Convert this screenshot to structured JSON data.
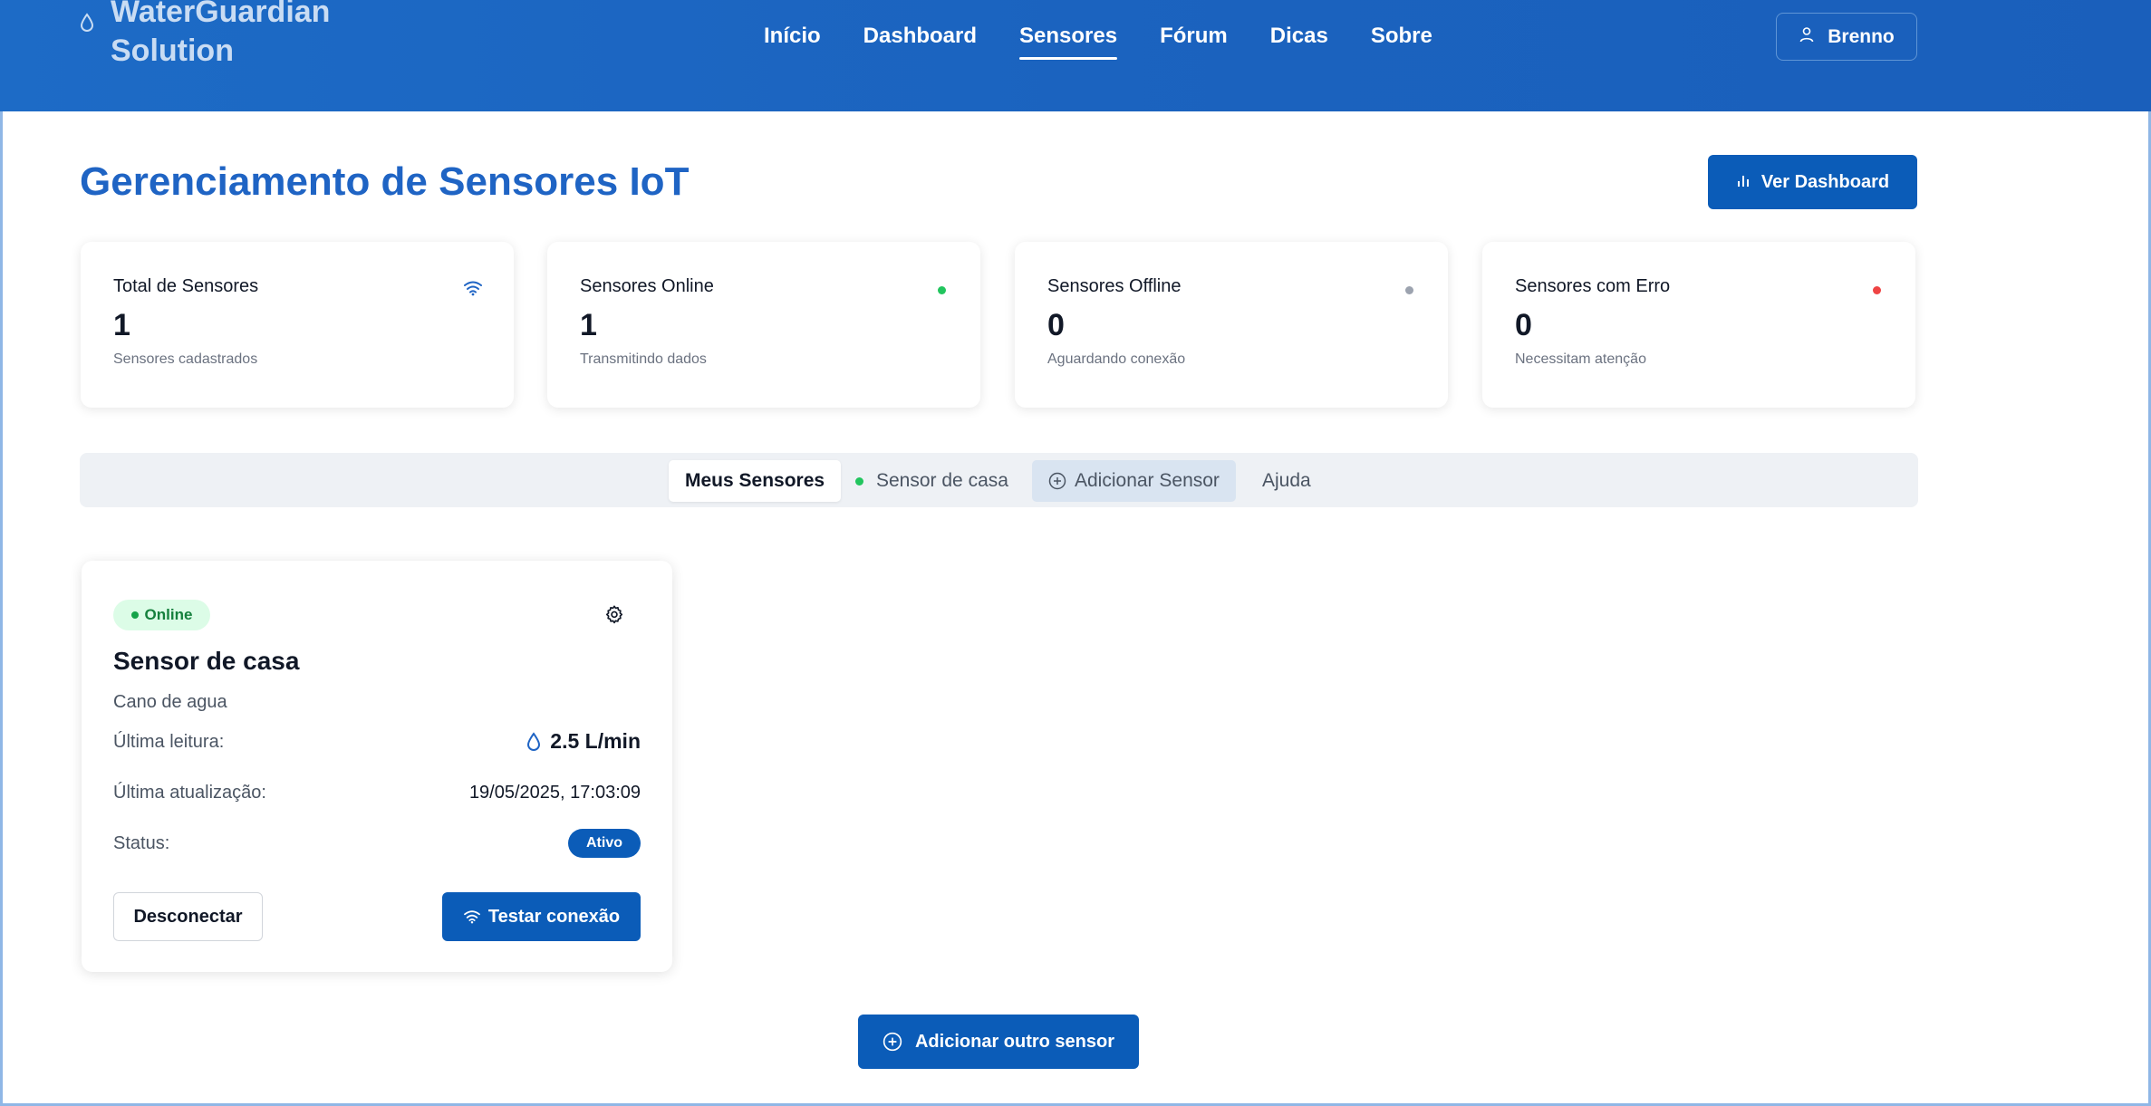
{
  "brand": {
    "name_line1": "WaterGuardian",
    "name_line2": "Solution"
  },
  "nav": {
    "items": [
      {
        "label": "Início"
      },
      {
        "label": "Dashboard"
      },
      {
        "label": "Sensores",
        "active": true
      },
      {
        "label": "Fórum"
      },
      {
        "label": "Dicas"
      },
      {
        "label": "Sobre"
      }
    ]
  },
  "user": {
    "name": "Brenno"
  },
  "page": {
    "title": "Gerenciamento de Sensores IoT",
    "dashboard_button": "Ver Dashboard"
  },
  "stats": [
    {
      "title": "Total de Sensores",
      "value": "1",
      "subtitle": "Sensores cadastrados",
      "icon": "wifi-icon"
    },
    {
      "title": "Sensores Online",
      "value": "1",
      "subtitle": "Transmitindo dados",
      "color": "#22c55e"
    },
    {
      "title": "Sensores Offline",
      "value": "0",
      "subtitle": "Aguardando conexão",
      "color": "#9ca3af"
    },
    {
      "title": "Sensores com Erro",
      "value": "0",
      "subtitle": "Necessitam atenção",
      "color": "#ef4444"
    }
  ],
  "tabs": {
    "my_sensors": "Meus Sensores",
    "sensor_home": "Sensor de casa",
    "add_sensor": "Adicionar Sensor",
    "help": "Ajuda"
  },
  "sensor": {
    "badge": "Online",
    "name": "Sensor de casa",
    "location": "Cano de agua",
    "last_reading_label": "Última leitura:",
    "last_reading_value": "2.5 L/min",
    "last_update_label": "Última atualização:",
    "last_update_value": "19/05/2025, 17:03:09",
    "status_label": "Status:",
    "status_value": "Ativo",
    "disconnect_button": "Desconectar",
    "test_button": "Testar conexão"
  },
  "add_other_button": "Adicionar outro sensor",
  "colors": {
    "primary": "#0b5cb8",
    "header": "#1b63bf",
    "title": "#1f64c4",
    "online": "#22c55e"
  }
}
